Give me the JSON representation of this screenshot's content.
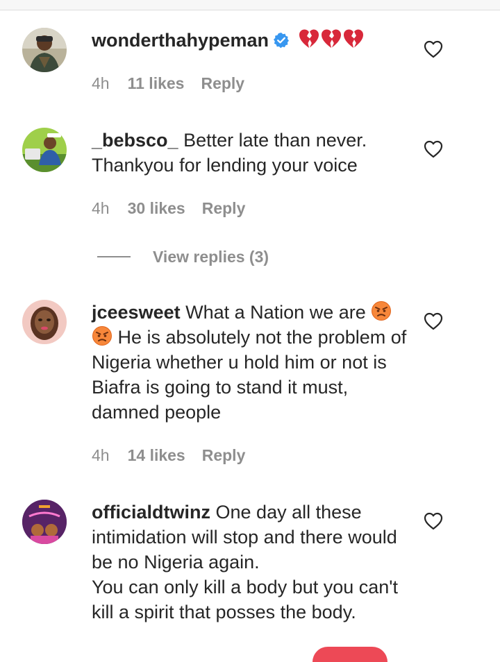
{
  "comments": [
    {
      "username": "wonderthahypeman",
      "verified": true,
      "text": "",
      "emojis": [
        "broken-heart",
        "broken-heart",
        "broken-heart"
      ],
      "time": "4h",
      "likes": "11 likes",
      "reply": "Reply"
    },
    {
      "username": "_bebsco_",
      "verified": false,
      "text": "Better late than never. Thankyou for lending your voice",
      "time": "4h",
      "likes": "30 likes",
      "reply": "Reply"
    },
    {
      "username": "jceesweet",
      "verified": false,
      "text_before_emoji": "What a Nation we are",
      "emojis": [
        "angry-face",
        "angry-face"
      ],
      "text_after_emoji": "He is absolutely not the problem of Nigeria whether u hold him or not is Biafra is going to stand it must, damned people",
      "time": "4h",
      "likes": "14 likes",
      "reply": "Reply"
    },
    {
      "username": "officialdtwinz",
      "verified": false,
      "text": "One day all these intimidation will stop and there would be no Nigeria again.",
      "text_line2": "You can only kill a body but you can't kill a spirit that posses the body."
    }
  ],
  "view_replies": "View replies (3)",
  "colors": {
    "text": "#262626",
    "muted": "#8e8e8e",
    "verified": "#3897f0",
    "accent": "#ed4956"
  },
  "icons": [
    "heart-outline-icon",
    "verified-badge-icon",
    "broken-heart-emoji",
    "angry-face-emoji"
  ]
}
